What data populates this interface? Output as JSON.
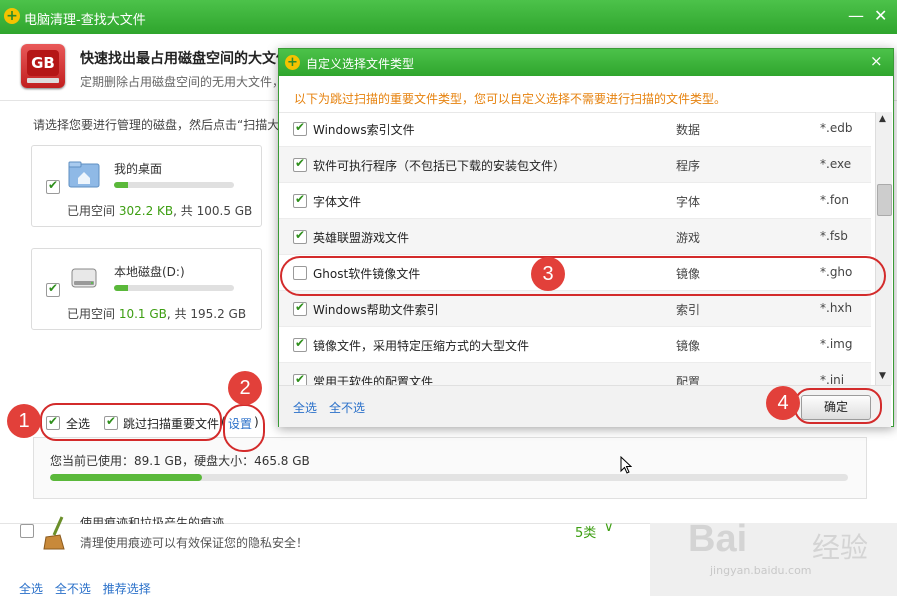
{
  "main_window": {
    "title": "电脑清理-查找大文件",
    "header_title": "快速找出最占用磁盘空间的大文件",
    "header_subtitle": "定期删除占用磁盘空间的无用大文件，",
    "gb_icon_text": "GB",
    "instruction": "请选择您要进行管理的磁盘，然后点击“扫描大"
  },
  "drives": [
    {
      "name": "我的桌面",
      "checked": true,
      "used_label": "已用空间",
      "used": "302.2 KB",
      "total_sep": ", 共",
      "total": "100.5 GB",
      "fill_fraction": 0.12,
      "icon": "desktop-folder-icon"
    },
    {
      "name": "本地磁盘(D:)",
      "checked": true,
      "used_label": "已用空间",
      "used": "10.1 GB",
      "total_sep": ", 共",
      "total": "195.2 GB",
      "fill_fraction": 0.12,
      "icon": "hard-disk-icon"
    }
  ],
  "options": {
    "select_all_label": "全选",
    "skip_important_label": "跳过扫描重要文件",
    "paren_open": "(",
    "settings_link": "设置",
    "paren_close": ")"
  },
  "disk_summary": {
    "text": "您当前已使用：89.1 GB，硬盘大小：465.8 GB",
    "fill_fraction": 0.19
  },
  "lower_item": {
    "title": "使用痕迹和垃圾产生的痕迹",
    "description": "清理使用痕迹可以有效保证您的隐私安全！",
    "count": "5类",
    "chevron": "∨"
  },
  "footer_links": [
    "全选",
    "全不选",
    "推荐选择"
  ],
  "dialog": {
    "title": "自定义选择文件类型",
    "close_symbol": "×",
    "notice": "以下为跳过扫描的重要文件类型，您可以自定义选择不需要进行扫描的文件类型。",
    "rows": [
      {
        "name": "Windows索引文件",
        "type": "数据",
        "ext": "*.edb",
        "checked": true
      },
      {
        "name": "软件可执行程序（不包括已下载的安装包文件）",
        "type": "程序",
        "ext": "*.exe",
        "checked": true
      },
      {
        "name": "字体文件",
        "type": "字体",
        "ext": "*.fon",
        "checked": true
      },
      {
        "name": "英雄联盟游戏文件",
        "type": "游戏",
        "ext": "*.fsb",
        "checked": true
      },
      {
        "name": "Ghost软件镜像文件",
        "type": "镜像",
        "ext": "*.gho",
        "checked": false
      },
      {
        "name": "Windows帮助文件索引",
        "type": "索引",
        "ext": "*.hxh",
        "checked": true
      },
      {
        "name": "镜像文件，采用特定压缩方式的大型文件",
        "type": "镜像",
        "ext": "*.img",
        "checked": true
      },
      {
        "name": "常用于软件的配置文件",
        "type": "配置",
        "ext": "*.ini",
        "checked": true
      }
    ],
    "select_all": "全选",
    "select_none": "全不选",
    "ok_label": "确定"
  },
  "annotations": [
    "1",
    "2",
    "3",
    "4"
  ],
  "watermark": {
    "brand": "Bai",
    "brand_cn": "经验",
    "url": "jingyan.baidu.com"
  },
  "colors": {
    "titlebar_green": "#38ad35",
    "accent_green": "#5ab83a",
    "link_blue": "#2a70c9",
    "notice_orange": "#e6820e",
    "annotation_red": "#e2403a"
  }
}
